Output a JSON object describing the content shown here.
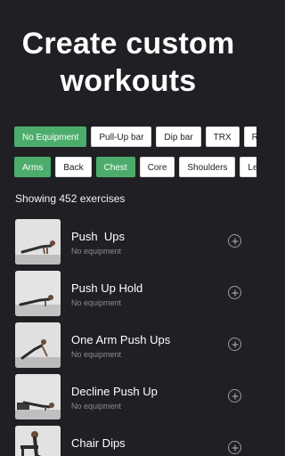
{
  "headline": {
    "line1": "Create custom",
    "line2": "workouts"
  },
  "equipment_filters": [
    {
      "label": "No Equipment",
      "active": true
    },
    {
      "label": "Pull-Up bar",
      "active": false
    },
    {
      "label": "Dip bar",
      "active": false
    },
    {
      "label": "TRX",
      "active": false
    },
    {
      "label": "Rin",
      "active": false
    }
  ],
  "muscle_filters": [
    {
      "label": "Arms",
      "active": true
    },
    {
      "label": "Back",
      "active": false
    },
    {
      "label": "Chest",
      "active": true
    },
    {
      "label": "Core",
      "active": false
    },
    {
      "label": "Shoulders",
      "active": false
    },
    {
      "label": "Legs",
      "active": false
    }
  ],
  "results": {
    "count_label": "Showing 452 exercises"
  },
  "exercises": [
    {
      "name": "Push  Ups",
      "subtitle": "No equipment"
    },
    {
      "name": "Push Up Hold",
      "subtitle": "No equipment"
    },
    {
      "name": "One Arm Push Ups",
      "subtitle": "No equipment"
    },
    {
      "name": "Decline Push Up",
      "subtitle": "No equipment"
    },
    {
      "name": "Chair Dips",
      "subtitle": ""
    }
  ],
  "colors": {
    "background": "#202024",
    "accent": "#4cac6c",
    "chip": "#ffffff",
    "subtitle": "#8c8c90"
  },
  "icons": {
    "add": "plus-circle-icon"
  }
}
